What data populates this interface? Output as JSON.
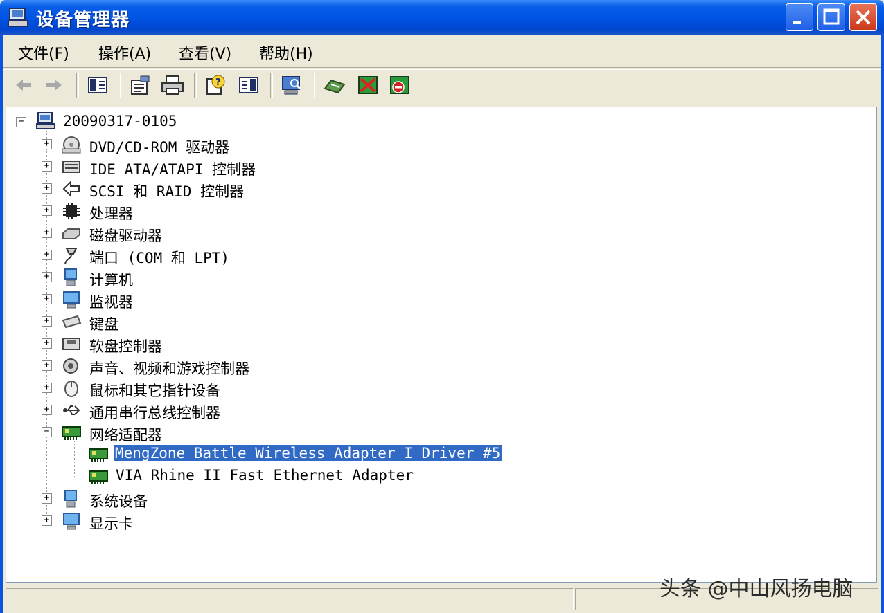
{
  "window": {
    "title": "设备管理器"
  },
  "menu": [
    {
      "label": "文件(F)"
    },
    {
      "label": "操作(A)"
    },
    {
      "label": "查看(V)"
    },
    {
      "label": "帮助(H)"
    }
  ],
  "toolbar": {
    "buttons": [
      {
        "icon": "back-arrow-icon"
      },
      {
        "icon": "forward-arrow-icon"
      },
      {
        "icon": "show-hide-tree-icon"
      },
      {
        "icon": "properties-icon"
      },
      {
        "icon": "print-icon"
      },
      {
        "icon": "help-icon"
      },
      {
        "icon": "show-hide-action-pane-icon"
      },
      {
        "icon": "scan-hardware-icon"
      },
      {
        "icon": "update-driver-icon"
      },
      {
        "icon": "uninstall-icon"
      },
      {
        "icon": "disable-icon"
      }
    ]
  },
  "tree": {
    "root": {
      "label": "20090317-0105",
      "expander": "−"
    },
    "categories": [
      {
        "label": "DVD/CD-ROM 驱动器",
        "icon": "cdrom-icon",
        "expander": "+"
      },
      {
        "label": "IDE ATA/ATAPI 控制器",
        "icon": "ide-controller-icon",
        "expander": "+"
      },
      {
        "label": "SCSI 和 RAID 控制器",
        "icon": "scsi-icon",
        "expander": "+"
      },
      {
        "label": "处理器",
        "icon": "processor-icon",
        "expander": "+"
      },
      {
        "label": "磁盘驱动器",
        "icon": "disk-drive-icon",
        "expander": "+"
      },
      {
        "label": "端口 (COM 和 LPT)",
        "icon": "port-icon",
        "expander": "+"
      },
      {
        "label": "计算机",
        "icon": "computer-icon",
        "expander": "+"
      },
      {
        "label": "监视器",
        "icon": "monitor-icon",
        "expander": "+"
      },
      {
        "label": "键盘",
        "icon": "keyboard-icon",
        "expander": "+"
      },
      {
        "label": "软盘控制器",
        "icon": "floppy-controller-icon",
        "expander": "+"
      },
      {
        "label": "声音、视频和游戏控制器",
        "icon": "sound-icon",
        "expander": "+"
      },
      {
        "label": "鼠标和其它指针设备",
        "icon": "mouse-icon",
        "expander": "+"
      },
      {
        "label": "通用串行总线控制器",
        "icon": "usb-icon",
        "expander": "+"
      },
      {
        "label": "网络适配器",
        "icon": "network-adapter-icon",
        "expander": "−"
      },
      {
        "label": "系统设备",
        "icon": "system-device-icon",
        "expander": "+"
      },
      {
        "label": "显示卡",
        "icon": "display-adapter-icon",
        "expander": "+"
      }
    ],
    "network_children": [
      {
        "label": "MengZone Battle Wireless Adapter I Driver #5",
        "selected": true
      },
      {
        "label": "VIA Rhine II Fast Ethernet Adapter",
        "selected": false
      }
    ]
  },
  "watermark": {
    "text": "头条 @中山风扬电脑"
  },
  "colors": {
    "titlebar": "#0055e5",
    "selection": "#316ac5",
    "chrome": "#ece9d8"
  }
}
